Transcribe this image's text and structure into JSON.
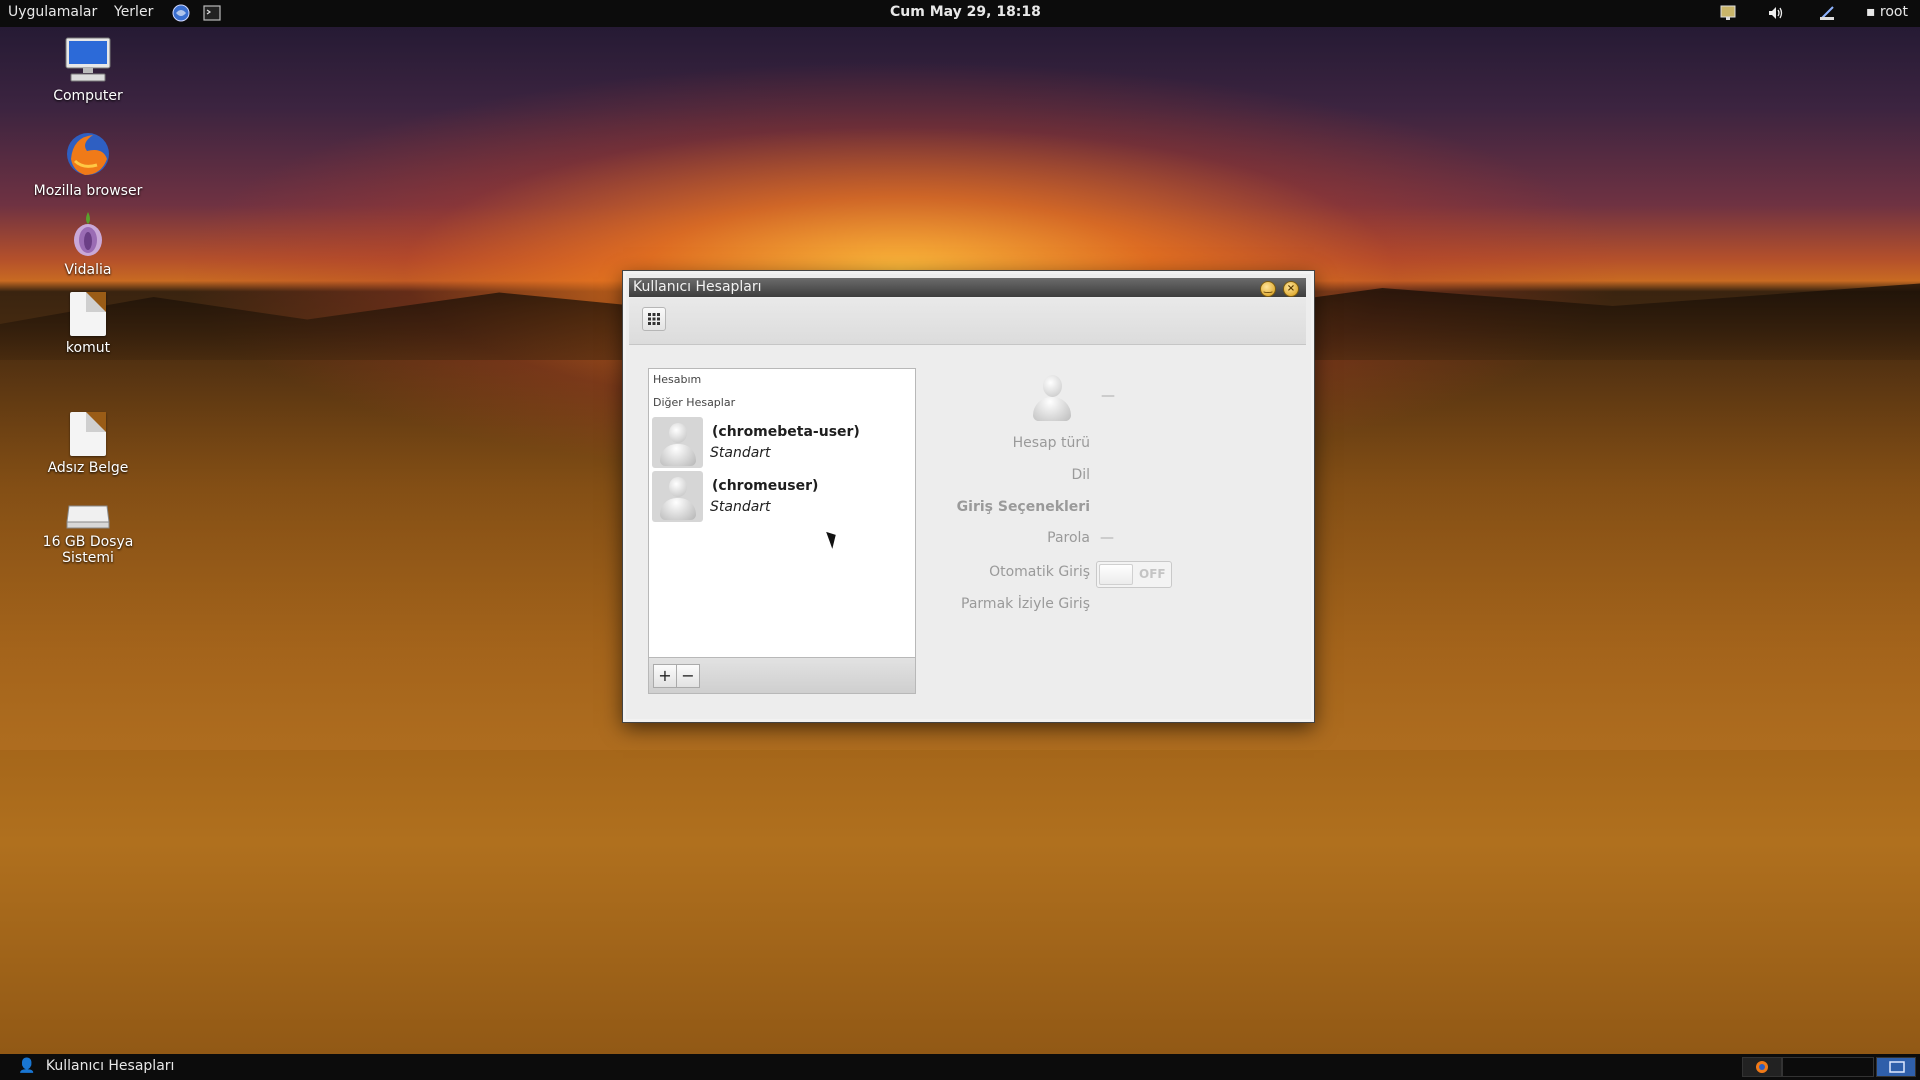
{
  "topbar": {
    "apps": "Uygulamalar",
    "places": "Yerler",
    "clock": "Cum May 29, 18:18",
    "user": "root"
  },
  "desktop": {
    "icons": [
      {
        "label": "Computer",
        "icon": "computer-icon"
      },
      {
        "label": "Mozilla browser",
        "icon": "firefox-icon"
      },
      {
        "label": "Vidalia",
        "icon": "onion-icon"
      },
      {
        "label": "komut",
        "icon": "document-icon"
      },
      {
        "label": "Adsız Belge",
        "icon": "document-icon"
      },
      {
        "label": "16 GB Dosya Sistemi",
        "icon": "drive-icon"
      }
    ]
  },
  "window": {
    "title": "Kullanıcı Hesapları",
    "list": {
      "my_account": "Hesabım",
      "other_accounts": "Diğer Hesaplar",
      "accounts": [
        {
          "name": "(chromebeta-user)",
          "type": "Standart"
        },
        {
          "name": "(chromeuser)",
          "type": "Standart"
        }
      ],
      "add_label": "+",
      "remove_label": "−"
    },
    "details": {
      "name_value": "—",
      "account_type_label": "Hesap türü",
      "language_label": "Dil",
      "login_options_label": "Giriş Seçenekleri",
      "password_label": "Parola",
      "password_value": "—",
      "auto_login_label": "Otomatik Giriş",
      "auto_login_state": "OFF",
      "fingerprint_label": "Parmak İziyle Giriş"
    }
  },
  "taskbar": {
    "task_label": "Kullanıcı Hesapları"
  },
  "colors": {
    "panel": "#0c0c0c",
    "window_bg": "#ededed",
    "title_accent": "#d69a12"
  }
}
